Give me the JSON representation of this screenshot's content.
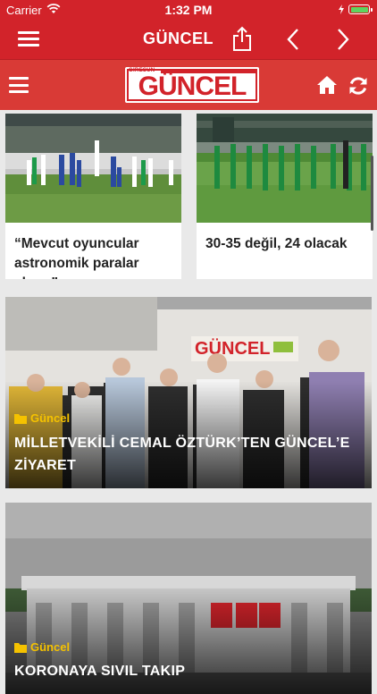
{
  "status_bar": {
    "carrier": "Carrier",
    "time": "1:32 PM"
  },
  "nav_bar": {
    "title": "GÜNCEL",
    "icons": [
      "menu-icon",
      "share-icon",
      "chevron-left-icon",
      "chevron-right-icon"
    ]
  },
  "header": {
    "logo_text": "GÜNCEL",
    "logo_pre": "GİRESUN",
    "icons": [
      "menu-icon",
      "home-icon",
      "refresh-icon"
    ]
  },
  "articles": [
    {
      "headline": "“Mevcut oyuncular astronomik paralar alıyor”"
    },
    {
      "headline": "30-35 değil, 24 olacak"
    },
    {
      "category": "Güncel",
      "headline": "MİLLETVEKİLİ CEMAL ÖZTÜRK’TEN GÜNCEL’E ZİYARET"
    },
    {
      "category": "Güncel",
      "headline": "KORONAYA SIVIL TAKIP"
    }
  ],
  "colors": {
    "brand_red": "#d2232a",
    "header_red": "#d93a36",
    "category_yellow": "#f5c200",
    "background": "#e9e9e9"
  }
}
